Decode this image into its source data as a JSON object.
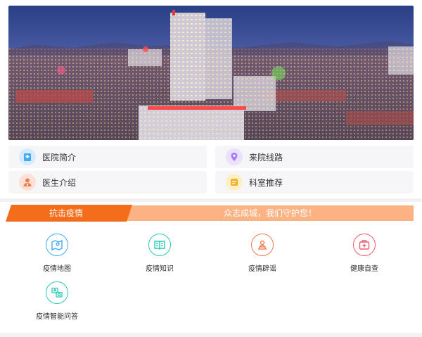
{
  "banner": {
    "alt": "hospital-night-view"
  },
  "quick_links": [
    {
      "label": "医院简介",
      "icon": "hospital-icon",
      "color": "#3fa9f5"
    },
    {
      "label": "来院线路",
      "icon": "route-icon",
      "color": "#a97ef0"
    },
    {
      "label": "医生介绍",
      "icon": "doctor-icon",
      "color": "#f07d52"
    },
    {
      "label": "科室推荐",
      "icon": "department-icon",
      "color": "#f5b225"
    }
  ],
  "epidemic": {
    "title": "抗击疫情",
    "slogan": "众志成城，我们守护您！",
    "accent": "#f46d1b",
    "accent_light": "#fbb383"
  },
  "features": [
    {
      "label": "疫情地图",
      "icon": "map-icon",
      "color": "#3fa9f5"
    },
    {
      "label": "疫情知识",
      "icon": "book-icon",
      "color": "#2ec9b5"
    },
    {
      "label": "疫情辟谣",
      "icon": "rumor-icon",
      "color": "#f07d52"
    },
    {
      "label": "健康自查",
      "icon": "medical-kit-icon",
      "color": "#f05a6e"
    },
    {
      "label": "疫情智能问答",
      "icon": "qa-icon",
      "color": "#2ec9b5"
    }
  ]
}
